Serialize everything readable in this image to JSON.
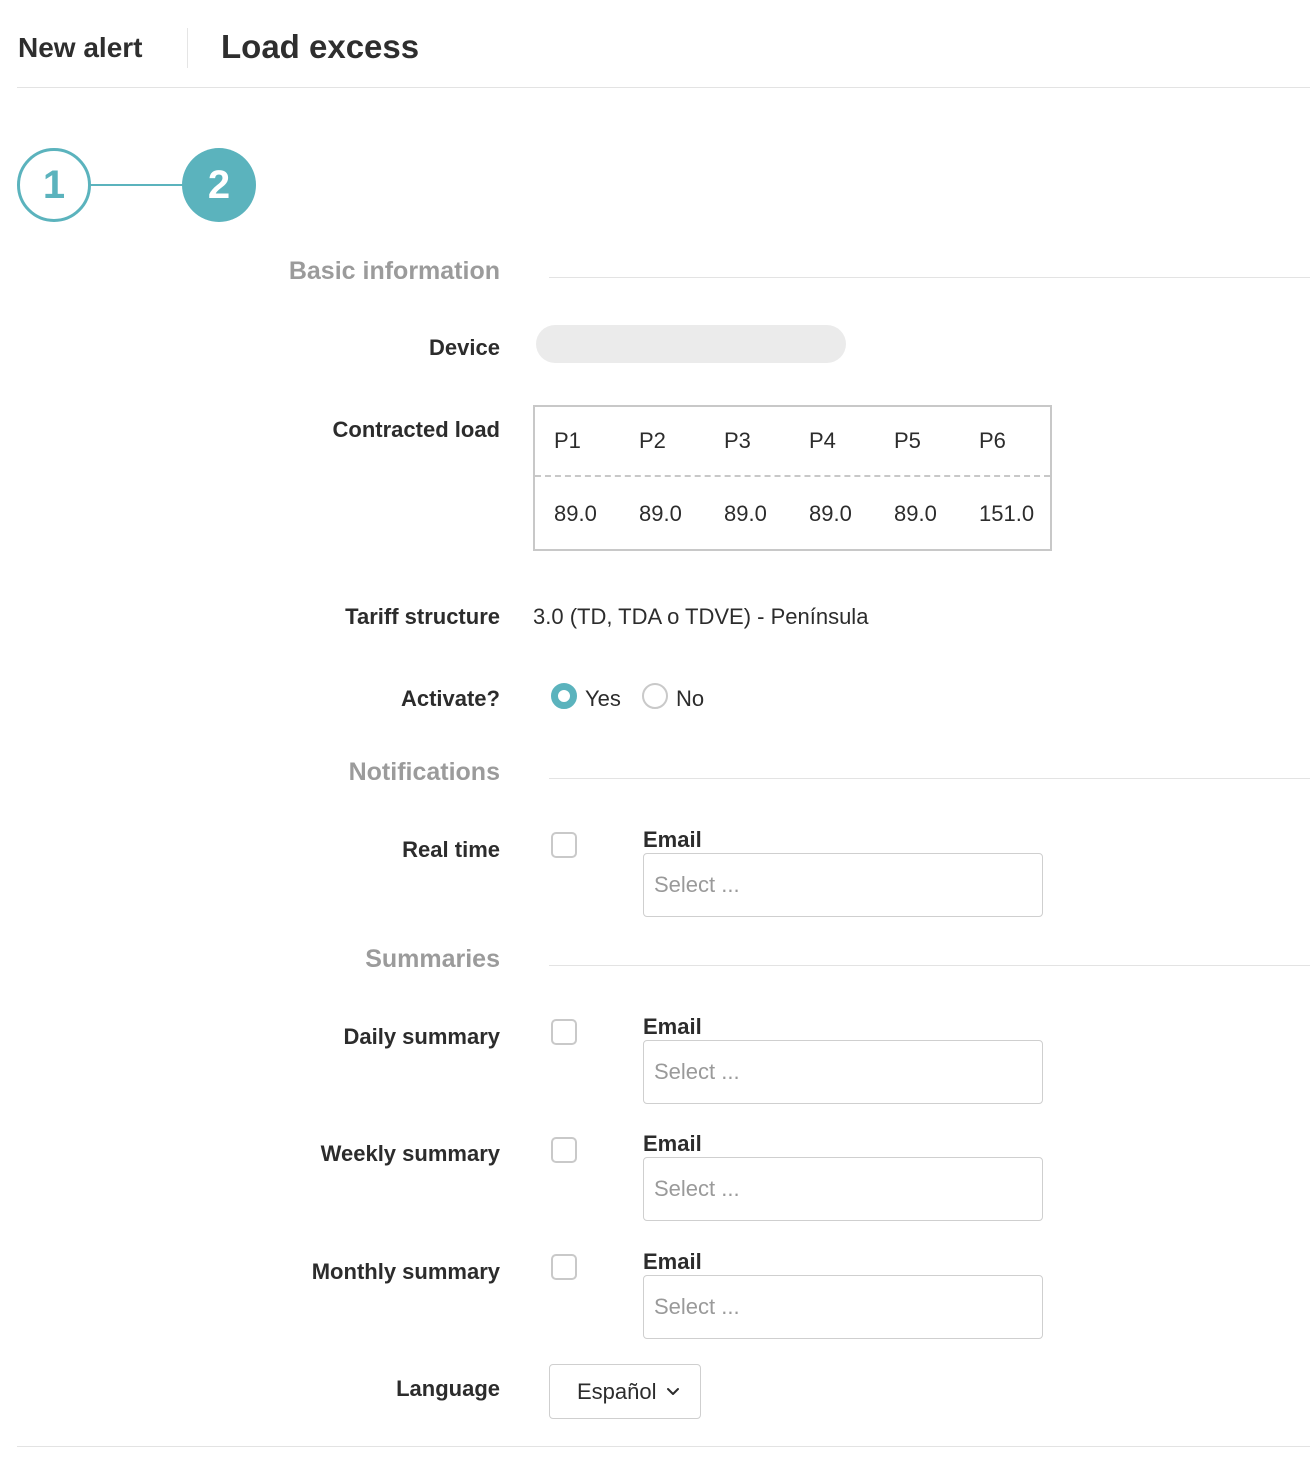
{
  "header": {
    "breadcrumb": "New alert",
    "title": "Load excess"
  },
  "stepper": {
    "steps": [
      "1",
      "2"
    ],
    "active_step": 2,
    "accent_color": "#5bb3bd"
  },
  "sections": {
    "basic_information": "Basic information",
    "notifications": "Notifications",
    "summaries": "Summaries"
  },
  "fields": {
    "device": {
      "label": "Device",
      "value": ""
    },
    "contracted_load": {
      "label": "Contracted load",
      "periods": [
        "P1",
        "P2",
        "P3",
        "P4",
        "P5",
        "P6"
      ],
      "values": [
        "89.0",
        "89.0",
        "89.0",
        "89.0",
        "89.0",
        "151.0"
      ]
    },
    "tariff_structure": {
      "label": "Tariff structure",
      "value": "3.0 (TD, TDA o TDVE) - Península"
    },
    "activate": {
      "label": "Activate?",
      "options": [
        "Yes",
        "No"
      ],
      "selected": "Yes"
    },
    "real_time": {
      "label": "Real time",
      "checked": false,
      "email_label": "Email",
      "email_placeholder": "Select ..."
    },
    "daily_summary": {
      "label": "Daily summary",
      "checked": false,
      "email_label": "Email",
      "email_placeholder": "Select ..."
    },
    "weekly_summary": {
      "label": "Weekly summary",
      "checked": false,
      "email_label": "Email",
      "email_placeholder": "Select ..."
    },
    "monthly_summary": {
      "label": "Monthly summary",
      "checked": false,
      "email_label": "Email",
      "email_placeholder": "Select ..."
    },
    "language": {
      "label": "Language",
      "value": "Español"
    }
  },
  "icons": {
    "language_dropdown": "chevron-down-icon"
  }
}
